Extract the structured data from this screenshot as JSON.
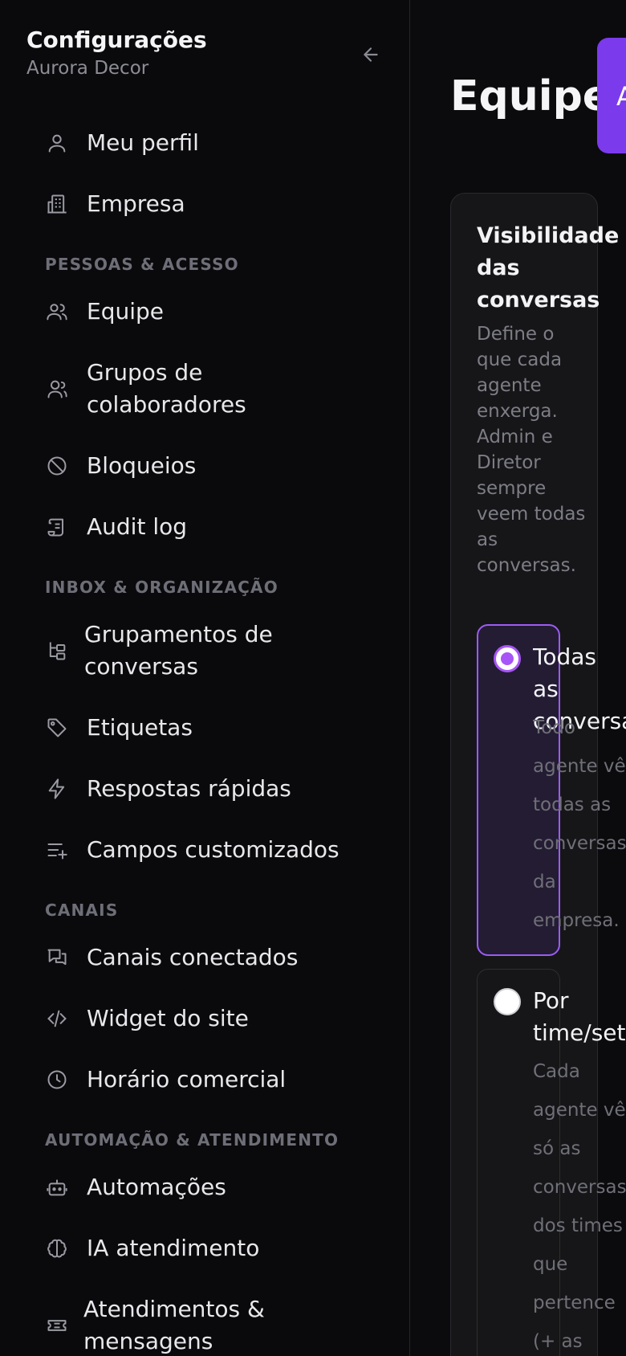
{
  "sidebar": {
    "title": "Configurações",
    "subtitle": "Aurora Decor",
    "back_icon": "arrow-left-icon",
    "sections": {
      "people": "PESSOAS & ACESSO",
      "inbox": "INBOX & ORGANIZAÇÃO",
      "channels": "CANAIS",
      "automation": "AUTOMAÇÃO & ATENDIMENTO"
    },
    "items": [
      {
        "label": "Meu perfil",
        "icon": "user-icon"
      },
      {
        "label": "Empresa",
        "icon": "building-icon"
      },
      {
        "label": "Equipe",
        "icon": "users-icon"
      },
      {
        "label": "Grupos de colaboradores",
        "icon": "user-group-icon"
      },
      {
        "label": "Bloqueios",
        "icon": "ban-icon"
      },
      {
        "label": "Audit log",
        "icon": "scroll-icon"
      },
      {
        "label": "Grupamentos de conversas",
        "icon": "tree-icon"
      },
      {
        "label": "Etiquetas",
        "icon": "tag-icon"
      },
      {
        "label": "Respostas rápidas",
        "icon": "bolt-icon"
      },
      {
        "label": "Campos customizados",
        "icon": "list-plus-icon"
      },
      {
        "label": "Canais conectados",
        "icon": "chat-icon"
      },
      {
        "label": "Widget do site",
        "icon": "code-icon"
      },
      {
        "label": "Horário comercial",
        "icon": "clock-icon"
      },
      {
        "label": "Automações",
        "icon": "bot-icon"
      },
      {
        "label": "IA atendimento",
        "icon": "brain-icon"
      },
      {
        "label": "Atendimentos & mensagens",
        "icon": "ticket-icon"
      }
    ]
  },
  "main": {
    "title": "Equipe",
    "add_button_label": "A",
    "card": {
      "title": "Visibilidade das conversas",
      "description": "Define o que cada agente enxerga. Admin e Diretor sempre veem todas as conversas.",
      "options": [
        {
          "title": "Todas as conversas",
          "description": "Todo agente vê todas as conversas da empresa.",
          "selected": true
        },
        {
          "title": "Por time/setor",
          "description": "Cada agente vê só as conversas dos times que pertence (+ as aind",
          "selected": false
        }
      ]
    }
  },
  "colors": {
    "accent": "#7c3aed",
    "radio_selected": "#a855f7"
  }
}
